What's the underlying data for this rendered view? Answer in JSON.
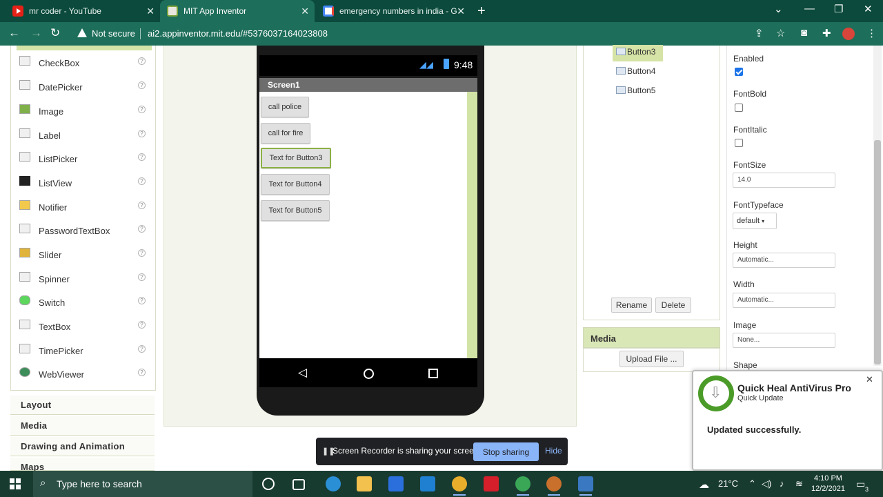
{
  "browser": {
    "tabs": [
      {
        "title": "mr coder - YouTube"
      },
      {
        "title": "MIT App Inventor"
      },
      {
        "title": "emergency numbers in india - G"
      }
    ],
    "address": {
      "security_label": "Not secure",
      "url": "ai2.appinventor.mit.edu/#5376037164023808"
    }
  },
  "palette": {
    "items": [
      {
        "label": "CheckBox",
        "help": "?"
      },
      {
        "label": "DatePicker",
        "help": "?"
      },
      {
        "label": "Image",
        "help": "?"
      },
      {
        "label": "Label",
        "help": "?"
      },
      {
        "label": "ListPicker",
        "help": "?"
      },
      {
        "label": "ListView",
        "help": "?"
      },
      {
        "label": "Notifier",
        "help": "?"
      },
      {
        "label": "PasswordTextBox",
        "help": "?"
      },
      {
        "label": "Slider",
        "help": "?"
      },
      {
        "label": "Spinner",
        "help": "?"
      },
      {
        "label": "Switch",
        "help": "?"
      },
      {
        "label": "TextBox",
        "help": "?"
      },
      {
        "label": "TimePicker",
        "help": "?"
      },
      {
        "label": "WebViewer",
        "help": "?"
      }
    ],
    "categories": [
      "Layout",
      "Media",
      "Drawing and Animation",
      "Maps"
    ]
  },
  "viewer": {
    "clock": "9:48",
    "screen_title": "Screen1",
    "buttons": [
      "call police",
      "call for fire",
      "Text for Button3",
      "Text for Button4",
      "Text for Button5"
    ],
    "selected_button_index": 2
  },
  "components": {
    "items": [
      "Button3",
      "Button4",
      "Button5"
    ],
    "selected": "Button3",
    "rename_label": "Rename",
    "delete_label": "Delete",
    "media_title": "Media",
    "upload_label": "Upload File ..."
  },
  "properties": {
    "enabled_label": "Enabled",
    "enabled": true,
    "fontbold_label": "FontBold",
    "fontbold": false,
    "fontitalic_label": "FontItalic",
    "fontitalic": false,
    "fontsize_label": "FontSize",
    "fontsize_value": "14.0",
    "fonttypeface_label": "FontTypeface",
    "fonttypeface_value": "default",
    "height_label": "Height",
    "height_value": "Automatic...",
    "width_label": "Width",
    "width_value": "Automatic...",
    "image_label": "Image",
    "image_value": "None...",
    "shape_label": "Shape"
  },
  "notification": {
    "title": "Quick Heal AntiVirus Pro",
    "subtitle": "Quick Update",
    "message": "Updated successfully.",
    "close": "✕"
  },
  "share_bar": {
    "text": "Screen Recorder is sharing your screen.",
    "stop_label": "Stop sharing",
    "hide_label": "Hide"
  },
  "taskbar": {
    "search_placeholder": "Type here to search",
    "weather": "21°C",
    "time": "4:10 PM",
    "date": "12/2/2021",
    "notification_count": "3"
  }
}
